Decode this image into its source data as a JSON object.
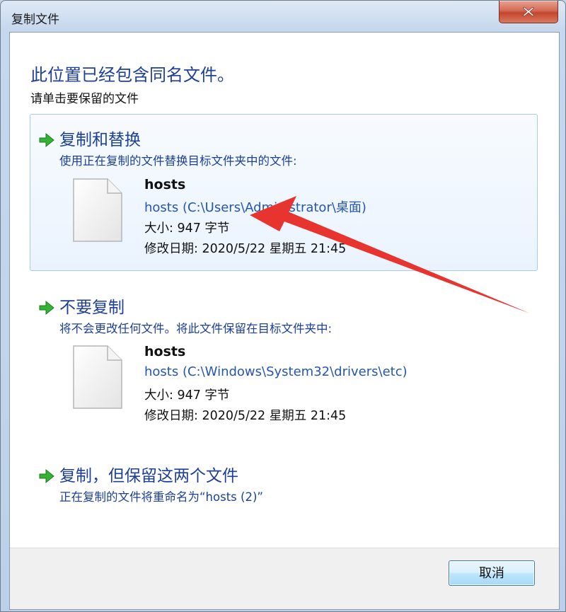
{
  "window": {
    "title": "复制文件"
  },
  "header": {
    "heading": "此位置已经包含同名文件。",
    "subheading": "请单击要保留的文件"
  },
  "options": [
    {
      "title": "复制和替换",
      "description": "使用正在复制的文件替换目标文件夹中的文件:",
      "file": {
        "name": "hosts",
        "path": "hosts (C:\\Users\\Administrator\\桌面)",
        "size": "大小: 947 字节",
        "modified": "修改日期: 2020/5/22 星期五 21:45"
      }
    },
    {
      "title": "不要复制",
      "description": "将不会更改任何文件。将此文件保留在目标文件夹中:",
      "file": {
        "name": "hosts",
        "path": "hosts (C:\\Windows\\System32\\drivers\\etc)",
        "size": "大小: 947 字节",
        "modified": "修改日期: 2020/5/22 星期五 21:45"
      }
    },
    {
      "title": "复制，但保留这两个文件",
      "description": "正在复制的文件将重命名为“hosts (2)”"
    }
  ],
  "footer": {
    "cancel_label": "取消"
  },
  "icons": {
    "option_arrow": "green-arrow-icon",
    "file": "file-icon",
    "annotation": "red-annotation-arrow"
  },
  "colors": {
    "heading": "#1e3f9a",
    "path_link": "#2455b5",
    "option_arrow": "#2faa2f",
    "annotation_arrow": "#e8342f",
    "hover_border": "#a9cbea"
  }
}
